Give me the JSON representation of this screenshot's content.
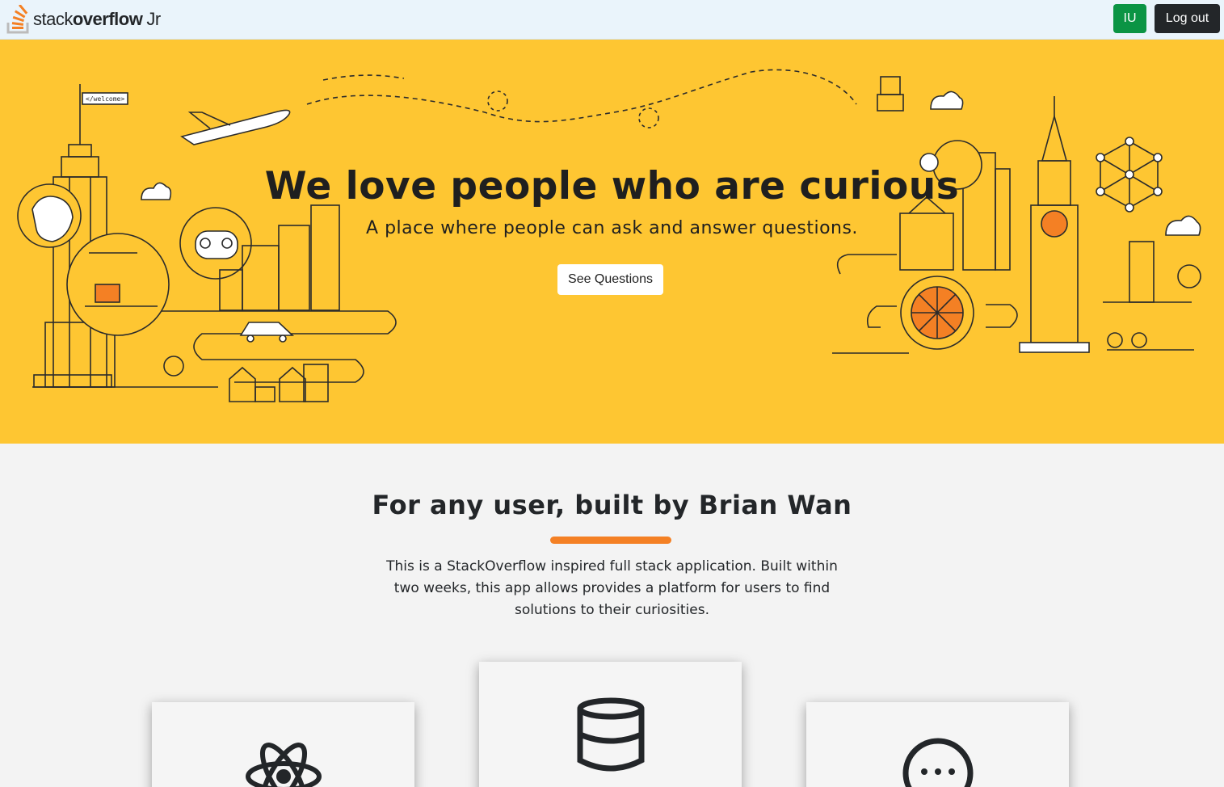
{
  "nav": {
    "logo_word1": "stack",
    "logo_word2": "overflow",
    "logo_word3": "Jr",
    "user_initials": "IU",
    "logout_label": "Log out"
  },
  "hero": {
    "title": "We love people who are curious",
    "subtitle": "A place where people can ask and answer questions.",
    "button_label": "See Questions",
    "flag_text": "</welcome>"
  },
  "about": {
    "title": "For any user, built by Brian Wan",
    "description": "This is a StackOverflow inspired full stack application. Built within two weeks, this app allows provides a platform for users to find solutions to their curiosities."
  },
  "features": [
    {
      "icon": "react-atom-icon"
    },
    {
      "icon": "database-icon"
    },
    {
      "icon": "chat-ellipsis-icon"
    }
  ],
  "colors": {
    "hero_background": "#fec632",
    "accent_bar": "#f48024",
    "nav_background": "#eaf4fb",
    "user_button": "#0b9444",
    "logout_button": "#232629"
  }
}
